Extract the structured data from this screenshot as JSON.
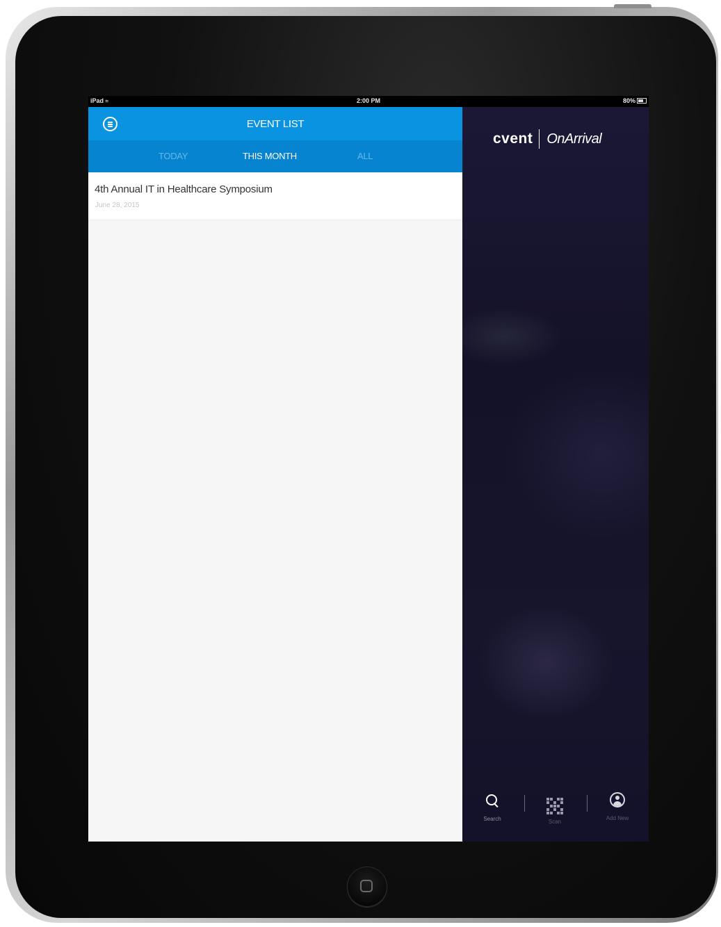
{
  "status_bar": {
    "carrier": "iPad",
    "time": "2:00 PM",
    "battery": "80%"
  },
  "header": {
    "title": "EVENT LIST"
  },
  "tabs": [
    {
      "label": "TODAY",
      "active": false
    },
    {
      "label": "THIS MONTH",
      "active": true
    },
    {
      "label": "ALL",
      "active": false
    }
  ],
  "events": [
    {
      "title": "4th Annual IT in Healthcare Symposium",
      "date": "June 28, 2015"
    }
  ],
  "brand": {
    "name": "cvent",
    "product": "OnArrival"
  },
  "actions": [
    {
      "label": "Search",
      "icon": "search-icon"
    },
    {
      "label": "Scan",
      "icon": "qr-code-icon"
    },
    {
      "label": "Add New",
      "icon": "user-icon"
    }
  ],
  "colors": {
    "header_blue": "#0a93e0",
    "tab_bar_blue": "#0784cf",
    "panel_background": "#f6f6f6",
    "sidebar_background": "#17152c"
  }
}
